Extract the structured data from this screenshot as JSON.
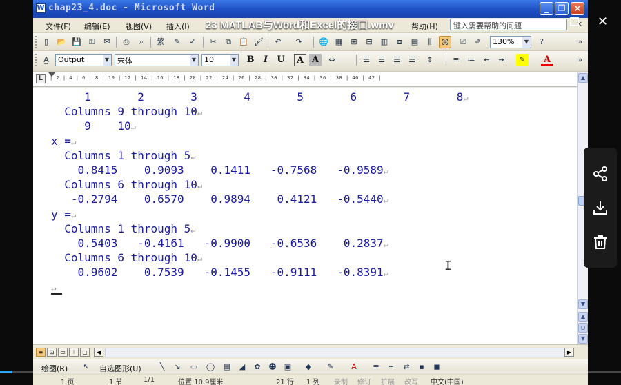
{
  "player": {
    "video_title": "23 MATLAB与Word和Excel的接口.wmv",
    "progress_percent": 2,
    "accent_color": "#2ea3ff",
    "side_actions": [
      "share-icon",
      "download-icon",
      "delete-icon"
    ]
  },
  "window": {
    "title": "chap23_4.doc - Microsoft Word",
    "titlebar_color": "#1e4fc4"
  },
  "menu": {
    "items": [
      "文件(F)",
      "编辑(E)",
      "视图(V)",
      "插入(I)",
      "帮助(H)"
    ],
    "help_placeholder": "键入需要帮助的问题",
    "close_glyph": "×"
  },
  "standard_toolbar": {
    "zoom": "130%"
  },
  "format_toolbar": {
    "style": "Output",
    "font": "宋体",
    "size": "10",
    "bold": "B",
    "italic": "I",
    "underline": "U",
    "char_border": "A",
    "char_shade": "A",
    "font_color": "A"
  },
  "ruler": {
    "ticks": "| 2 | 4 | 6 | 8 | 10 | 12 | 14 | 16 | 18 | 20 | 22 | 24 | 26 | 28 | 30 | 32 | 34 | 36 | 38 | 40 | 42 |"
  },
  "document": {
    "lines": [
      "     1       2       3       4       5       6       7       8",
      "  Columns 9 through 10",
      "     9    10",
      "x =",
      "  Columns 1 through 5",
      "    0.8415    0.9093    0.1411   -0.7568   -0.9589",
      "  Columns 6 through 10",
      "   -0.2794    0.6570    0.9894    0.4121   -0.5440",
      "y =",
      "  Columns 1 through 5",
      "    0.5403   -0.4161   -0.9900   -0.6536    0.2837",
      "  Columns 6 through 10",
      "    0.9602    0.7539   -0.1455   -0.9111   -0.8391",
      ""
    ],
    "text_color": "#1a1aa5"
  },
  "drawing_toolbar": {
    "draw_label": "绘图(R)",
    "autoshape_label": "自选图形(U)"
  },
  "status": {
    "page": "1 页",
    "section": "1 节",
    "page_of": "1/1",
    "position": "位置 10.9厘米",
    "line": "21 行",
    "column": "1 列",
    "rec": "录制",
    "trk": "修订",
    "ext": "扩展",
    "ovr": "改写",
    "lang": "中文(中国)"
  }
}
